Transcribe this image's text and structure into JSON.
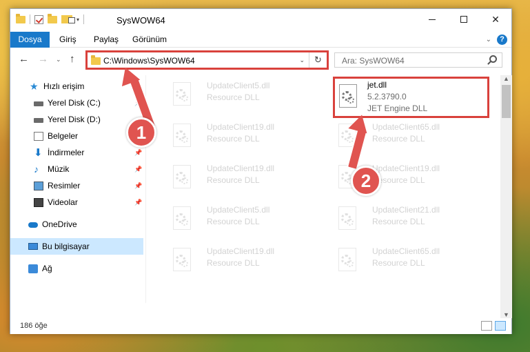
{
  "window": {
    "title": "SysWOW64",
    "controls": {
      "minimize": "–",
      "maximize": "☐",
      "close": "✕"
    }
  },
  "ribbon": {
    "tabs": [
      "Dosya",
      "Giriş",
      "Paylaş",
      "Görünüm"
    ],
    "help": "?"
  },
  "address_bar": {
    "path": "C:\\Windows\\SysWOW64",
    "refresh_symbol": "↻"
  },
  "search": {
    "placeholder": "Ara: SysWOW64"
  },
  "nav_pane": {
    "items": [
      {
        "label": "Hızlı erişim",
        "icon": "star-icon"
      },
      {
        "label": "Yerel Disk (C:)",
        "icon": "drive-icon",
        "pinned": true
      },
      {
        "label": "Yerel Disk (D:)",
        "icon": "drive-icon"
      },
      {
        "label": "Belgeler",
        "icon": "documents-icon"
      },
      {
        "label": "İndirmeler",
        "icon": "download-icon",
        "pinned": true
      },
      {
        "label": "Müzik",
        "icon": "music-icon",
        "pinned": true
      },
      {
        "label": "Resimler",
        "icon": "pictures-icon",
        "pinned": true
      },
      {
        "label": "Videolar",
        "icon": "videos-icon",
        "pinned": true
      },
      {
        "label": "OneDrive",
        "icon": "onedrive-icon"
      },
      {
        "label": "Bu bilgisayar",
        "icon": "this-pc-icon",
        "selected": true
      },
      {
        "label": "Ağ",
        "icon": "network-icon"
      }
    ]
  },
  "files": [
    {
      "name": "UpdateClient5.dll",
      "type": "Resource DLL"
    },
    {
      "name": "jet.dll",
      "version": "5.2.3790.0",
      "type": "JET Engine DLL",
      "highlighted": true
    },
    {
      "name": "UpdateClient19.dll",
      "type": "Resource DLL"
    },
    {
      "name": "UpdateClient65.dll",
      "type": "Resource DLL"
    },
    {
      "name": "UpdateClient19.dll",
      "type": "Resource DLL"
    },
    {
      "name": "UpdateClient19.dll",
      "type": "Resource DLL"
    },
    {
      "name": "UpdateClient5.dll",
      "type": "Resource DLL"
    },
    {
      "name": "UpdateClient21.dll",
      "type": "Resource DLL"
    },
    {
      "name": "UpdateClient19.dll",
      "type": "Resource DLL"
    },
    {
      "name": "UpdateClient65.dll",
      "type": "Resource DLL"
    }
  ],
  "status_bar": {
    "item_count": "186 öğe"
  },
  "annotations": {
    "step1": "1",
    "step2": "2"
  },
  "colors": {
    "accent": "#1979ca",
    "highlight_red": "#d9413c",
    "selection": "#cce8ff"
  }
}
